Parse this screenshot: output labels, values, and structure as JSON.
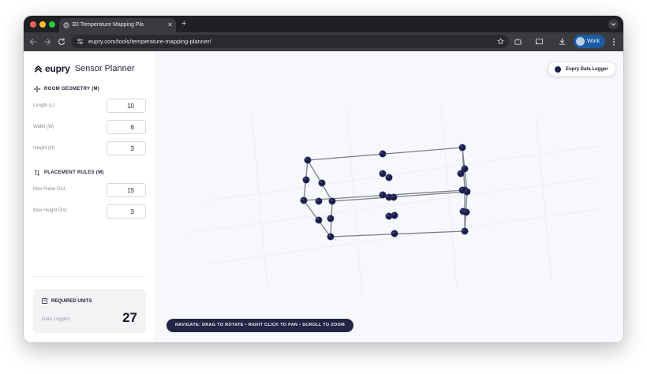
{
  "browser": {
    "tab_title": "3D Temperature Mapping Pla",
    "new_tab_label": "+",
    "url": "eupry.com/tools/temperature-mapping-planner/",
    "profile_label": "Work"
  },
  "sidebar": {
    "brand_name": "eupry",
    "product_name": "Sensor Planner",
    "room_geometry": {
      "title": "ROOM GEOMETRY (M)",
      "fields": [
        {
          "label": "Length (L)",
          "value": "10"
        },
        {
          "label": "Width (W)",
          "value": "6"
        },
        {
          "label": "Height (H)",
          "value": "3"
        }
      ]
    },
    "placement_rules": {
      "title": "PLACEMENT RULES (M)",
      "fields": [
        {
          "label": "Max Plane Dist",
          "value": "15"
        },
        {
          "label": "Max Height Dist",
          "value": "3"
        }
      ]
    },
    "required_units": {
      "title": "REQUIRED UNITS",
      "label": "Data Loggers",
      "count": "27"
    }
  },
  "viewport": {
    "legend_label": "Eupry Data Logger",
    "sensor_color": "#1c1d4a",
    "edge_color": "#7c7f8c",
    "nav_hint": "NAVIGATE: DRAG TO ROTATE • RIGHT CLICK TO PAN • SCROLL TO ZOOM"
  },
  "colors": {
    "accent_dark": "#232545",
    "chrome_bg": "#3a3b3e",
    "profile_bg": "#1b5da0"
  }
}
